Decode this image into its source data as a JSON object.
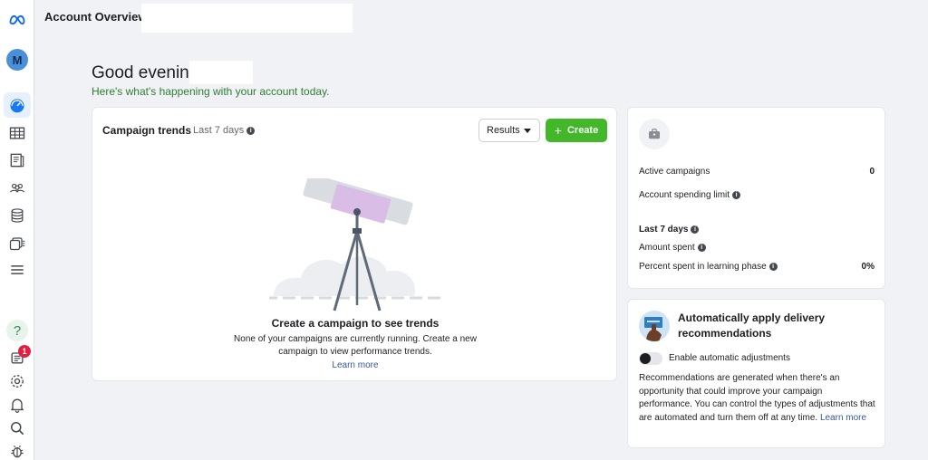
{
  "header": {
    "title": "Account Overview"
  },
  "rail": {
    "logo": "meta-logo-icon",
    "avatar_initial": "M",
    "items": [
      "dashboard-icon",
      "table-icon",
      "pages-icon",
      "audiences-icon",
      "billing-icon",
      "ads-library-icon",
      "menu-icon"
    ],
    "bottom": [
      "help-icon",
      "notifications-icon",
      "settings-icon",
      "bell-icon",
      "search-icon",
      "bug-icon"
    ],
    "notification_count": "1",
    "help_glyph": "?"
  },
  "greeting": {
    "text": "Good evening",
    "subtext": "Here's what's happening with your account today."
  },
  "trends": {
    "title": "Campaign trends",
    "range": "Last 7 days",
    "results_label": "Results",
    "create_label": "Create",
    "empty_title": "Create a campaign to see trends",
    "empty_text": "None of your campaigns are currently running. Create a new campaign to view performance trends.",
    "learn_more": "Learn more"
  },
  "stats": {
    "active_campaigns_label": "Active campaigns",
    "active_campaigns_value": "0",
    "spending_limit_label": "Account spending limit",
    "period_label": "Last 7 days",
    "amount_spent_label": "Amount spent",
    "learning_phase_label": "Percent spent in learning phase",
    "learning_phase_value": "0%"
  },
  "recommendations": {
    "title": "Automatically apply delivery recommendations",
    "toggle_label": "Enable automatic adjustments",
    "toggle_on": false,
    "text": "Recommendations are generated when there's an opportunity that could improve your campaign performance. You can control the types of adjustments that are automated and turn them off at any time.",
    "learn_more": "Learn more"
  },
  "colors": {
    "accent": "#1877f2",
    "create_green": "#42b72a",
    "greeting_green": "#2e7d32",
    "link": "#385898",
    "badge": "#e41e3f"
  }
}
